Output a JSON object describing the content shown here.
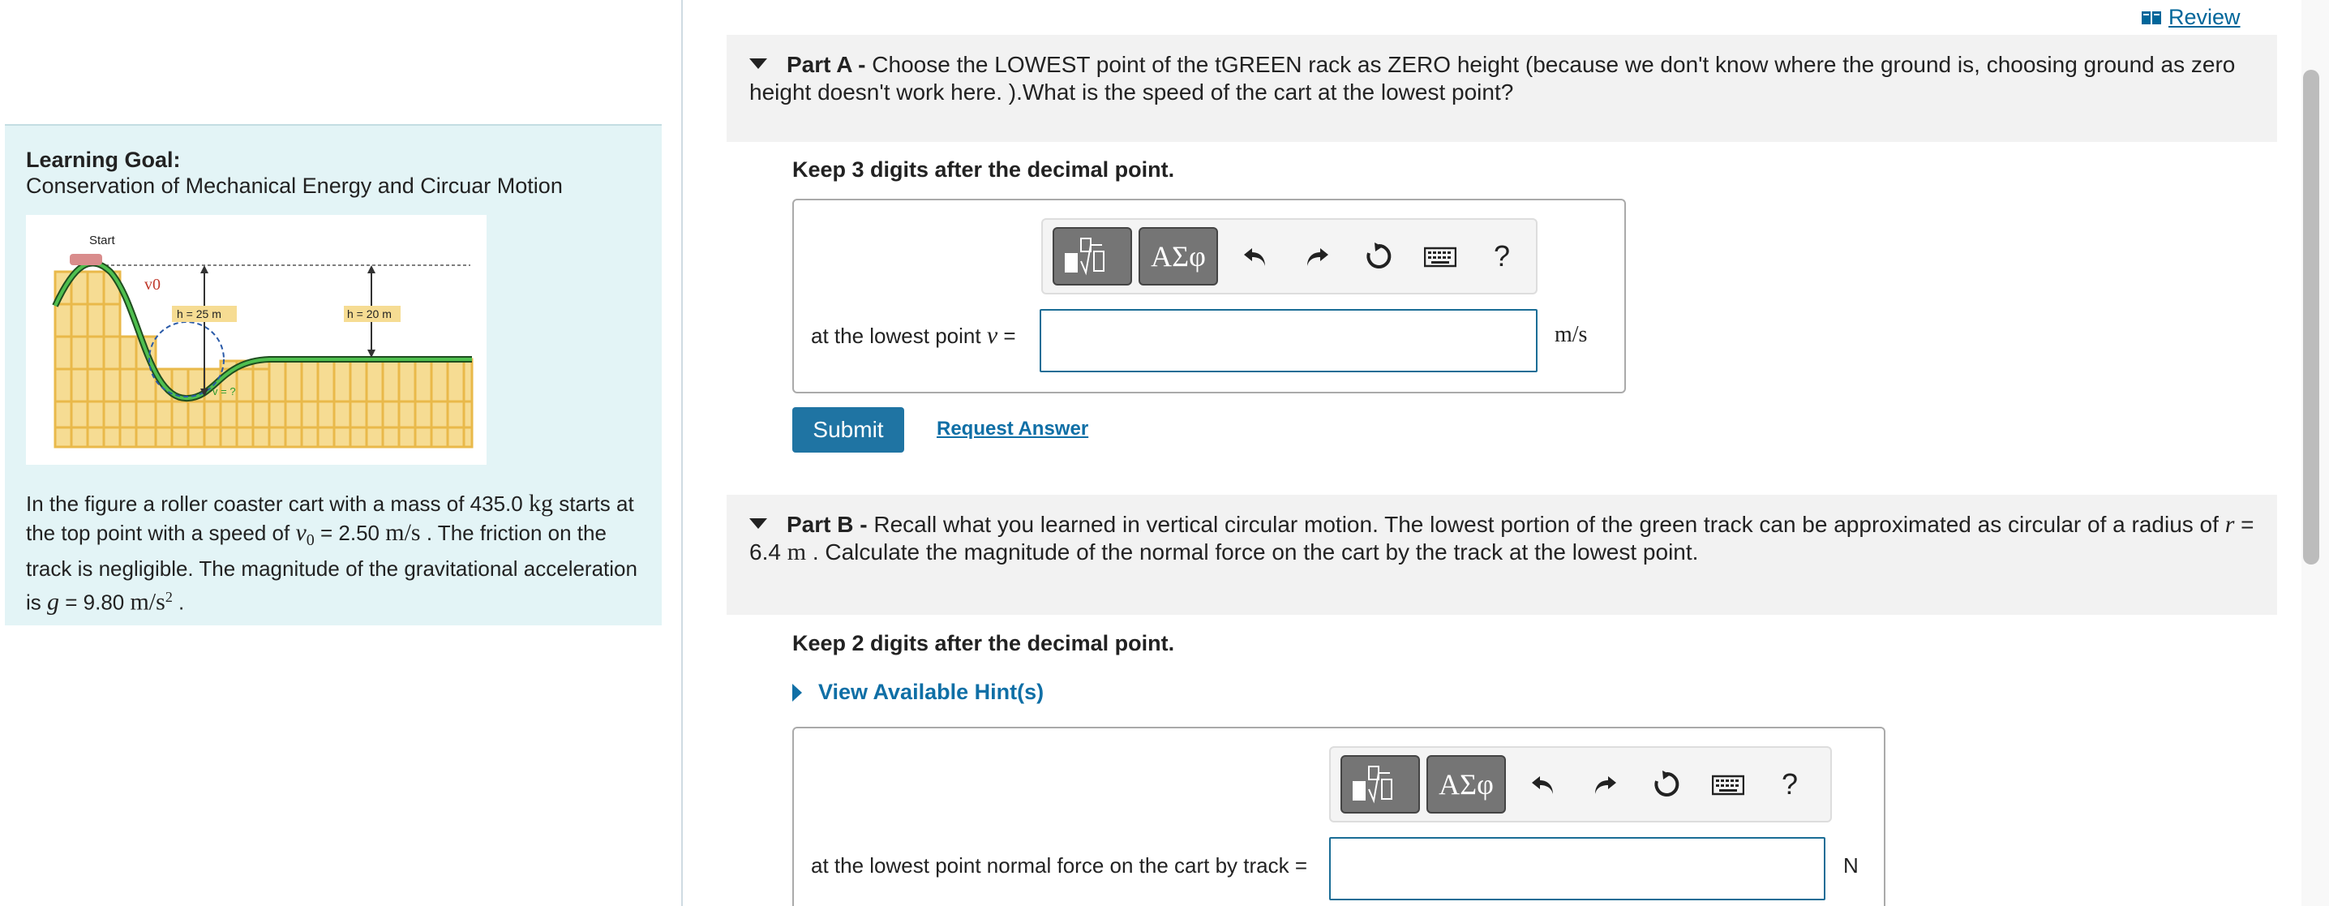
{
  "review": {
    "label": "Review"
  },
  "learning_goal": {
    "title": "Learning Goal:",
    "subtitle": "Conservation of Mechanical Energy and Circuar Motion"
  },
  "figure": {
    "start_label": "Start",
    "v0_label": "v0",
    "h1_label": "h = 25 m",
    "h2_label": "h = 20 m",
    "v_label": "v = ?"
  },
  "problem": {
    "text1": "In the figure a roller coaster cart with a mass of 435.0 ",
    "unit_kg": "kg",
    "text2": " starts at the top point with a speed of ",
    "v0": "v",
    "v0_sub": "0",
    "text3": " = 2.50 ",
    "unit_ms": "m/s",
    "text4": " . The friction on the track is negligible. The magnitude of the gravitational acceleration is ",
    "g": "g",
    "text5": " = 9.80 ",
    "unit_ms2": "m/s",
    "unit_ms2_sup": "2",
    "text6": " ."
  },
  "part_a": {
    "label": "Part A - ",
    "text": "Choose the LOWEST point of the tGREEN rack as ZERO height (because we don't know where the ground is, choosing ground as zero height doesn't work here. ).What is the speed of the cart at the lowest point?",
    "keep_digits": "Keep 3 digits after the decimal point.",
    "field_label": "at the lowest point ",
    "field_var": "v",
    "field_eq": " =",
    "unit": "m/s",
    "input_value": "",
    "submit": "Submit",
    "request": "Request Answer"
  },
  "part_b": {
    "label": "Part B - ",
    "text1": "Recall what you learned in vertical circular motion. The lowest portion of the green track can be approximated as circular of a radius of ",
    "r": "r",
    "text2": " = 6.4 ",
    "unit_m": "m",
    "text3": " .  Calculate the magnitude of the normal force on the cart by the track at the lowest point.",
    "keep_digits": "Keep 2 digits after the decimal point.",
    "hint": "View Available Hint(s)",
    "field_label": "at the lowest point  normal force on the cart by track =",
    "unit": "N",
    "input_value": ""
  },
  "toolbar": {
    "templates": "templates",
    "greek": "ΑΣφ",
    "undo": "undo",
    "redo": "redo",
    "reset": "reset",
    "keyboard": "keyboard",
    "help": "?"
  },
  "colors": {
    "accent": "#1f74a3",
    "link": "#0f6fa6",
    "panel_bg": "#e3f4f6",
    "track_green": "#2f8a2f",
    "scaffold": "#f0c864"
  }
}
